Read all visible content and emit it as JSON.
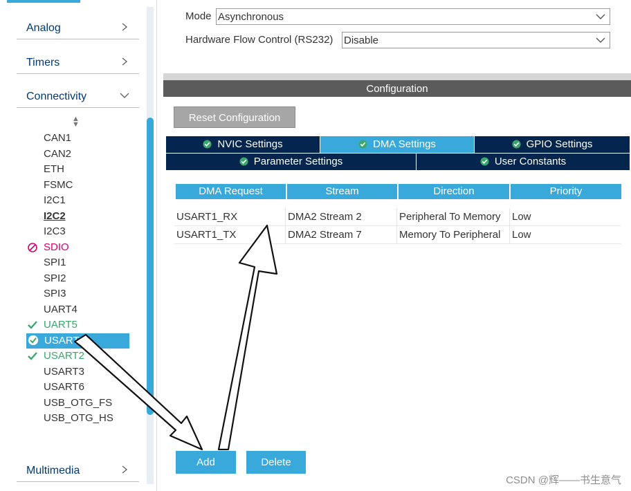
{
  "sidebar": {
    "categories": [
      {
        "label": "Analog",
        "icon": "chevron-right-icon"
      },
      {
        "label": "Timers",
        "icon": "chevron-right-icon"
      },
      {
        "label": "Connectivity",
        "icon": "chevron-down-icon"
      },
      {
        "label": "Multimedia",
        "icon": "chevron-right-icon"
      }
    ],
    "sort_icon": "sort-icon",
    "items": [
      {
        "label": "CAN1",
        "state": "normal"
      },
      {
        "label": "CAN2",
        "state": "normal"
      },
      {
        "label": "ETH",
        "state": "normal"
      },
      {
        "label": "FSMC",
        "state": "normal"
      },
      {
        "label": "I2C1",
        "state": "normal"
      },
      {
        "label": "I2C2",
        "state": "bold"
      },
      {
        "label": "I2C3",
        "state": "normal"
      },
      {
        "label": "SDIO",
        "state": "error",
        "icon": "forbidden-icon"
      },
      {
        "label": "SPI1",
        "state": "normal"
      },
      {
        "label": "SPI2",
        "state": "normal"
      },
      {
        "label": "SPI3",
        "state": "normal"
      },
      {
        "label": "UART4",
        "state": "normal"
      },
      {
        "label": "UART5",
        "state": "configured",
        "icon": "check-icon"
      },
      {
        "label": "USART1",
        "state": "selected",
        "icon": "check-circle-icon"
      },
      {
        "label": "USART2",
        "state": "configured",
        "icon": "check-icon"
      },
      {
        "label": "USART3",
        "state": "normal"
      },
      {
        "label": "USART6",
        "state": "normal"
      },
      {
        "label": "USB_OTG_FS",
        "state": "normal"
      },
      {
        "label": "USB_OTG_HS",
        "state": "normal"
      }
    ]
  },
  "mode": {
    "mode_label": "Mode",
    "mode_value": "Asynchronous",
    "hwfc_label": "Hardware Flow Control (RS232)",
    "hwfc_value": "Disable"
  },
  "configuration": {
    "title": "Configuration",
    "reset_label": "Reset Configuration",
    "tabs_row1": [
      {
        "label": "NVIC Settings",
        "active": false
      },
      {
        "label": "DMA Settings",
        "active": true
      },
      {
        "label": "GPIO Settings",
        "active": false
      }
    ],
    "tabs_row2": [
      {
        "label": "Parameter Settings",
        "active": false
      },
      {
        "label": "User Constants",
        "active": false
      }
    ],
    "table": {
      "headers": [
        "DMA Request",
        "Stream",
        "Direction",
        "Priority"
      ],
      "rows": [
        [
          "USART1_RX",
          "DMA2 Stream 2",
          "Peripheral To Memory",
          "Low"
        ],
        [
          "USART1_TX",
          "DMA2 Stream 7",
          "Memory To Peripheral",
          "Low"
        ]
      ]
    },
    "add_label": "Add",
    "delete_label": "Delete"
  },
  "watermark": "CSDN @辉——书生意气",
  "colors": {
    "accent": "#39a9dc",
    "tab_dark": "#04254d",
    "configured": "#3aa76d",
    "error": "#d6006e",
    "header_gray": "#5b5b5b"
  }
}
